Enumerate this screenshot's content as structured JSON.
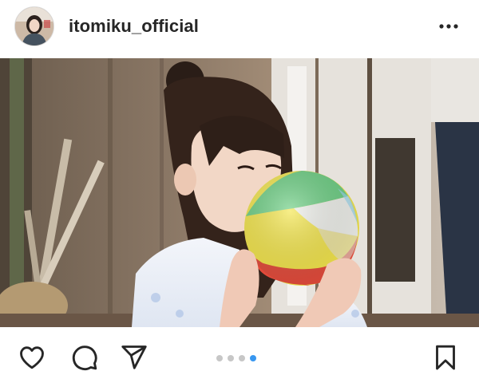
{
  "post": {
    "username": "itomiku_official",
    "icons": {
      "avatar": "profile-avatar",
      "more": "more-options-icon",
      "like": "heart-icon",
      "comment": "comment-icon",
      "share": "paper-plane-icon",
      "save": "bookmark-icon"
    },
    "carousel": {
      "total": 4,
      "active": 4
    },
    "colors": {
      "accent": "#3897f0",
      "text": "#262626",
      "inactive_dot": "#c7c7c7"
    }
  }
}
